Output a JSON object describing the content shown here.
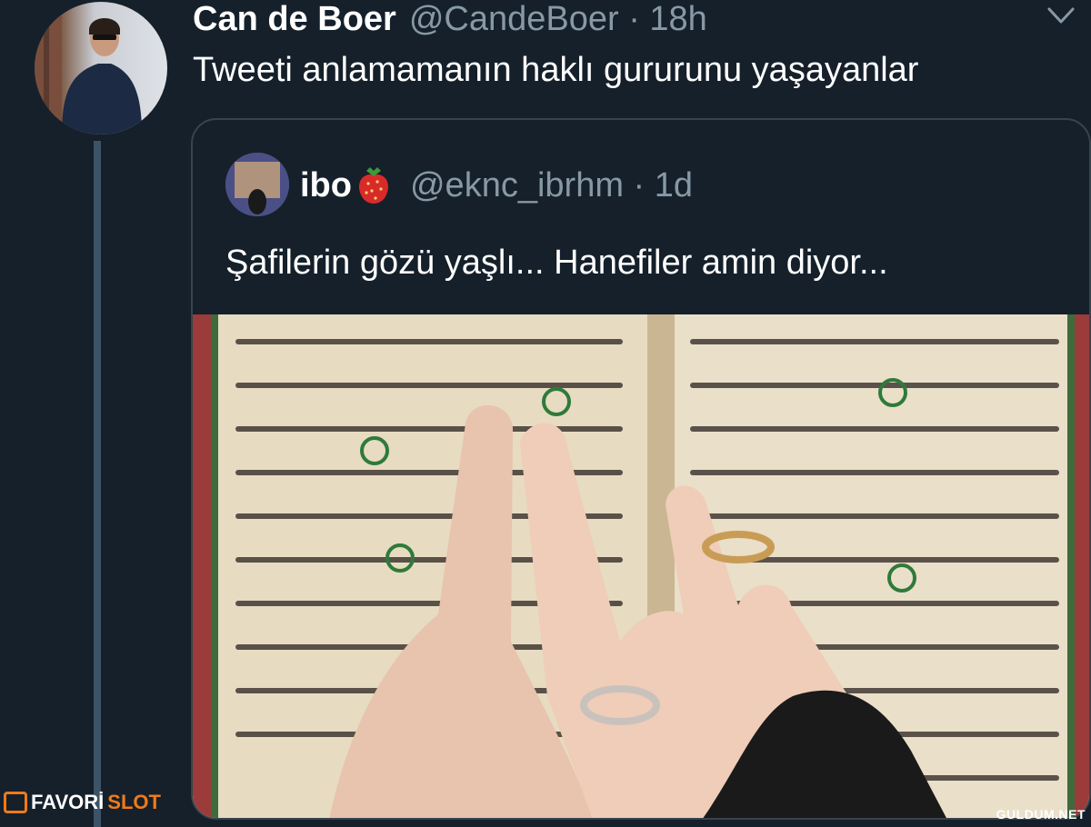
{
  "tweet": {
    "author_name": "Can de Boer",
    "handle_time": "@CandeBoer · 18h",
    "text": "Tweeti anlamamanın haklı gururunu yaşayanlar"
  },
  "quoted_tweet": {
    "author_name": "ibo",
    "emoji_icon": "strawberry-icon",
    "handle_time": "@eknc_ibrhm · 1d",
    "text": "Şafilerin gözü yaşlı... Hanefiler amin diyor..."
  },
  "watermarks": {
    "left_a": "FAVORİ",
    "left_b": "SLOT",
    "right": "GULDUM.NET"
  },
  "colors": {
    "background": "#15202b",
    "secondary_text": "#8899a6",
    "border": "#38444d",
    "thread_line": "#3d5466"
  }
}
